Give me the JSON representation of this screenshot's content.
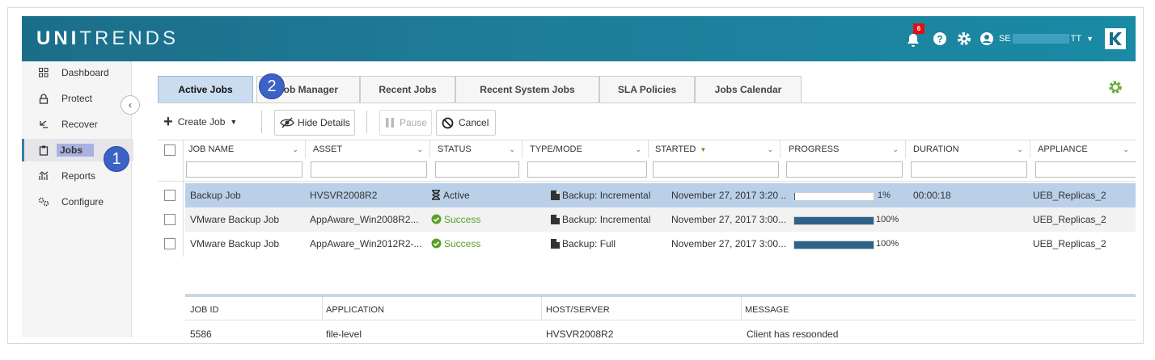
{
  "app": {
    "logo_bold": "UNI",
    "logo_rest": "TRENDS",
    "notification_count": "6",
    "user_prefix": "SE",
    "user_suffix": "TT"
  },
  "sidebar": {
    "items": [
      {
        "label": "Dashboard",
        "icon": "dashboard-icon"
      },
      {
        "label": "Protect",
        "icon": "lock-icon"
      },
      {
        "label": "Recover",
        "icon": "recover-icon"
      },
      {
        "label": "Jobs",
        "icon": "clipboard-icon"
      },
      {
        "label": "Reports",
        "icon": "reports-icon"
      },
      {
        "label": "Configure",
        "icon": "gears-icon"
      }
    ]
  },
  "callouts": {
    "one": "1",
    "two": "2"
  },
  "tabs": [
    {
      "label": "Active Jobs"
    },
    {
      "label": "Job Manager"
    },
    {
      "label": "Recent Jobs"
    },
    {
      "label": "Recent System Jobs"
    },
    {
      "label": "SLA Policies"
    },
    {
      "label": "Jobs Calendar"
    }
  ],
  "toolbar": {
    "create_job": "Create Job",
    "hide_details": "Hide Details",
    "pause": "Pause",
    "cancel": "Cancel"
  },
  "grid": {
    "columns": [
      "JOB NAME",
      "ASSET",
      "STATUS",
      "TYPE/MODE",
      "STARTED",
      "PROGRESS",
      "DURATION",
      "APPLIANCE"
    ],
    "rows": [
      {
        "job_name": "Backup Job",
        "asset": "HVSVR2008R2",
        "status": "Active",
        "type_mode": "Backup: Incremental",
        "started": "November 27, 2017 3:20 ...",
        "progress": 1,
        "progress_label": "1%",
        "duration": "00:00:18",
        "appliance": "UEB_Replicas_2"
      },
      {
        "job_name": "VMware Backup Job",
        "asset": "AppAware_Win2008R2...",
        "status": "Success",
        "type_mode": "Backup: Incremental",
        "started": "November 27, 2017 3:00...",
        "progress": 100,
        "progress_label": "100%",
        "duration": "",
        "appliance": "UEB_Replicas_2"
      },
      {
        "job_name": "VMware Backup Job",
        "asset": "AppAware_Win2012R2-...",
        "status": "Success",
        "type_mode": "Backup: Full",
        "started": "November 27, 2017 3:00...",
        "progress": 100,
        "progress_label": "100%",
        "duration": "",
        "appliance": "UEB_Replicas_2"
      }
    ]
  },
  "details": {
    "columns": [
      "JOB ID",
      "APPLICATION",
      "HOST/SERVER",
      "MESSAGE"
    ],
    "values": [
      "5586",
      "file-level",
      "HVSVR2008R2",
      "Client has responded"
    ]
  },
  "colors": {
    "header": "#1f7d99",
    "active_tab": "#c9dcf0",
    "selected_row": "#b9d0e8",
    "progress_fill": "#2e6289",
    "success": "#5aa02c",
    "callout": "#3b62c4"
  }
}
